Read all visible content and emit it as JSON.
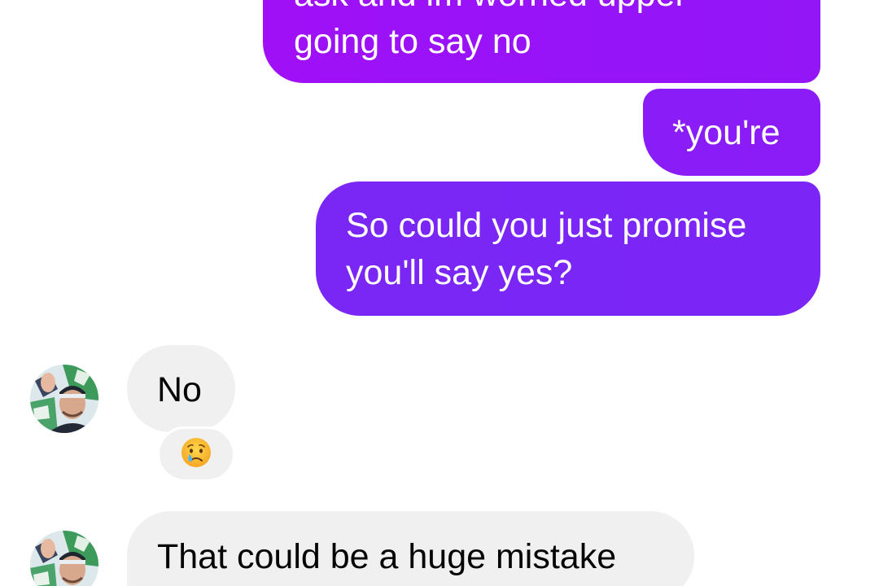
{
  "conversation": {
    "messages": [
      {
        "sender": "me",
        "lines": [
          "ask and im worried upper",
          "going to say no"
        ]
      },
      {
        "sender": "me",
        "text": "*you're"
      },
      {
        "sender": "me",
        "lines": [
          "So could you just promise",
          "you'll say yes?"
        ]
      },
      {
        "sender": "contact",
        "text": "No",
        "reaction": {
          "icon": "crying-face-icon",
          "emoji": "😢"
        }
      },
      {
        "sender": "contact",
        "text": "That could be a huge mistake"
      }
    ]
  },
  "colors": {
    "sent_gradient_top": "#a010f7",
    "sent_gradient_bottom": "#7a27f6",
    "received_bubble": "#f0f0f0",
    "received_text": "#050505",
    "sent_text": "#ffffff"
  }
}
